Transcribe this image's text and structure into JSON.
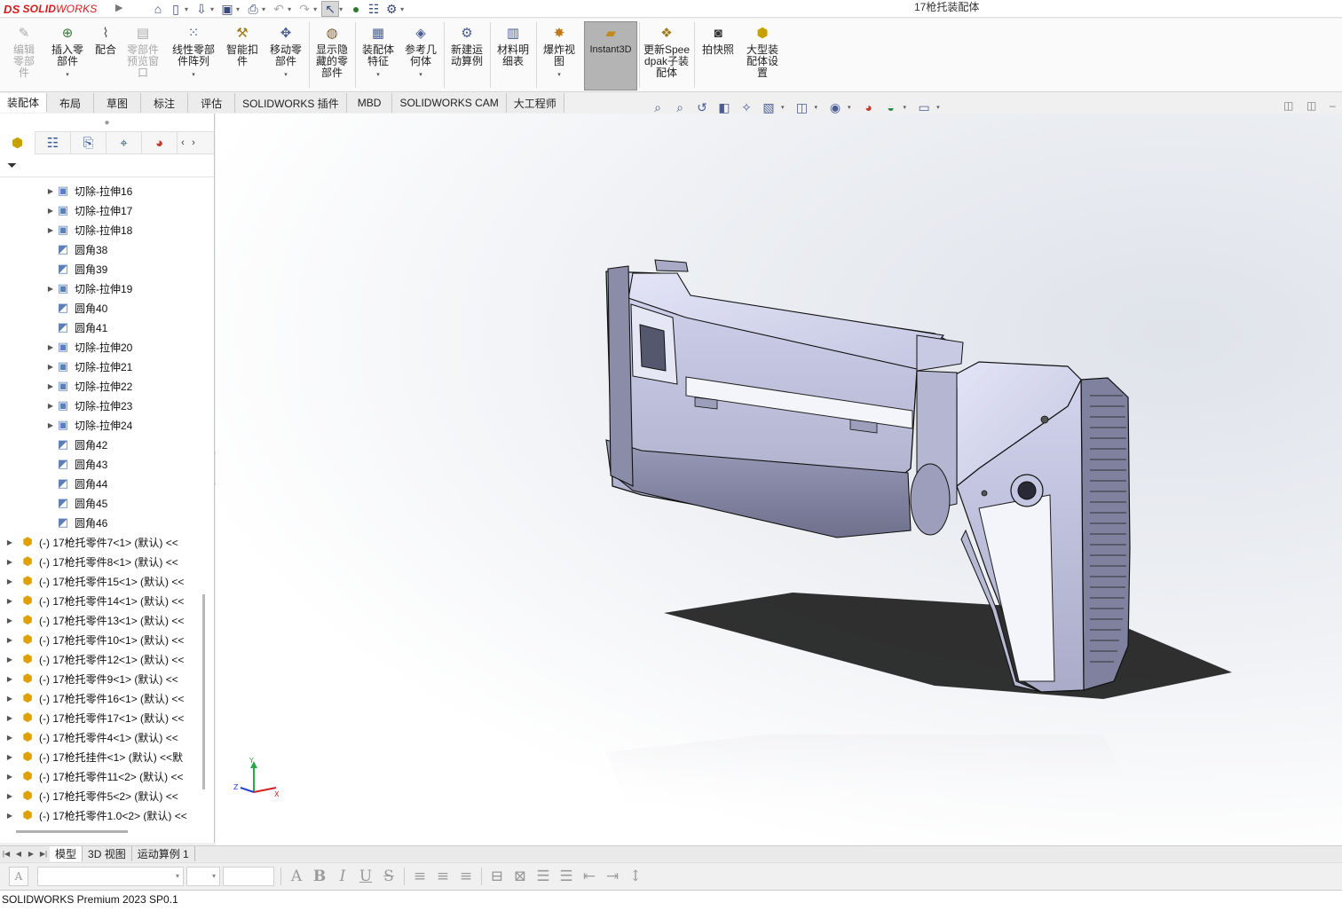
{
  "app": {
    "logo_ds": "DS",
    "logo_text": "SOLID",
    "logo_text2": "WORKS",
    "window_title": "17枪托装配体"
  },
  "quick_access": [
    "home-icon",
    "new-document-icon",
    "open-icon",
    "save-icon",
    "print-icon",
    "undo-icon",
    "redo-icon",
    "select-icon",
    "traffic-light-icon",
    "file-properties-icon",
    "options-gear-icon"
  ],
  "ribbon": {
    "edit_component": "编辑零部件",
    "insert_component": "插入零部件",
    "mate": "配合",
    "component_preview": "零部件预览窗口",
    "linear_pattern": "线性零部件阵列",
    "smart_fasteners": "智能扣件",
    "move_component": "移动零部件",
    "show_hidden": "显示隐藏的零部件",
    "assembly_features": "装配体特征",
    "reference_geometry": "参考几何体",
    "new_motion_study": "新建运动算例",
    "bill_of_materials": "材料明细表",
    "exploded_view": "爆炸视图",
    "instant3d": "Instant3D",
    "update_speedpak": "更新Speedpak子装配体",
    "take_snapshot": "拍快照",
    "large_assembly": "大型装配体设置"
  },
  "command_tabs": [
    "装配体",
    "布局",
    "草图",
    "标注",
    "评估",
    "SOLIDWORKS 插件",
    "MBD",
    "SOLIDWORKS CAM",
    "大工程师"
  ],
  "feature_tree": {
    "rows": [
      {
        "label": "切除-拉伸16",
        "expandable": true,
        "kind": "cut"
      },
      {
        "label": "切除-拉伸17",
        "expandable": true,
        "kind": "cut"
      },
      {
        "label": "切除-拉伸18",
        "expandable": true,
        "kind": "cut"
      },
      {
        "label": "圆角38",
        "expandable": false,
        "kind": "fillet"
      },
      {
        "label": "圆角39",
        "expandable": false,
        "kind": "fillet"
      },
      {
        "label": "切除-拉伸19",
        "expandable": true,
        "kind": "cut"
      },
      {
        "label": "圆角40",
        "expandable": false,
        "kind": "fillet"
      },
      {
        "label": "圆角41",
        "expandable": false,
        "kind": "fillet"
      },
      {
        "label": "切除-拉伸20",
        "expandable": true,
        "kind": "cut"
      },
      {
        "label": "切除-拉伸21",
        "expandable": true,
        "kind": "cut"
      },
      {
        "label": "切除-拉伸22",
        "expandable": true,
        "kind": "cut"
      },
      {
        "label": "切除-拉伸23",
        "expandable": true,
        "kind": "cut"
      },
      {
        "label": "切除-拉伸24",
        "expandable": true,
        "kind": "cut"
      },
      {
        "label": "圆角42",
        "expandable": false,
        "kind": "fillet"
      },
      {
        "label": "圆角43",
        "expandable": false,
        "kind": "fillet"
      },
      {
        "label": "圆角44",
        "expandable": false,
        "kind": "fillet"
      },
      {
        "label": "圆角45",
        "expandable": false,
        "kind": "fillet"
      },
      {
        "label": "圆角46",
        "expandable": false,
        "kind": "fillet"
      }
    ],
    "components": [
      "(-) 17枪托零件7<1> (默认) <<",
      "(-) 17枪托零件8<1> (默认) <<",
      "(-) 17枪托零件15<1> (默认) <<",
      "(-) 17枪托零件14<1> (默认) <<",
      "(-) 17枪托零件13<1> (默认) <<",
      "(-) 17枪托零件10<1> (默认) <<",
      "(-) 17枪托零件12<1> (默认) <<",
      "(-) 17枪托零件9<1> (默认) <<",
      "(-) 17枪托零件16<1> (默认) <<",
      "(-) 17枪托零件17<1> (默认) <<",
      "(-) 17枪托零件4<1> (默认) <<",
      "(-) 17枪托挂件<1> (默认) <<默",
      "(-) 17枪托零件11<2> (默认) <<",
      "(-) 17枪托零件5<2> (默认) <<",
      "(-) 17枪托零件1.0<2> (默认) <<"
    ]
  },
  "triad": {
    "x": "X",
    "y": "Y",
    "z": "Z"
  },
  "bottom_tabs": [
    "模型",
    "3D 视图",
    "运动算例 1"
  ],
  "format_bar": {
    "font_box": "A",
    "tools": [
      "A",
      "B",
      "I",
      "U",
      "S",
      "≡",
      "≡",
      "≡",
      "⊟",
      "⊠",
      "☰",
      "☰",
      "⇤",
      "⇥",
      "↕"
    ]
  },
  "status": {
    "text": "SOLIDWORKS Premium 2023 SP0.1"
  },
  "colors": {
    "accent": "#d7191c",
    "model": "#c9cbe6",
    "model_dark": "#8b8da8",
    "selected_tab": "#b4b4b4"
  }
}
